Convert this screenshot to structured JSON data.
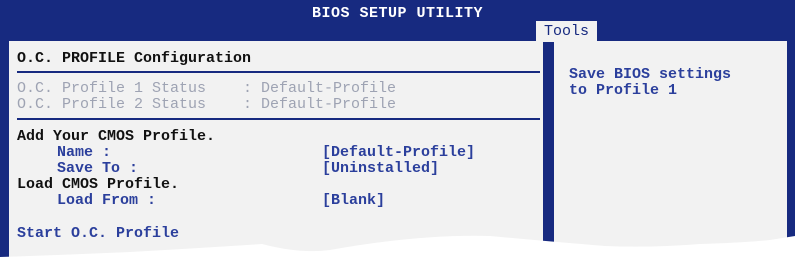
{
  "header": {
    "title": "BIOS SETUP UTILITY",
    "active_tab": "Tools"
  },
  "main": {
    "section_title": "O.C. PROFILE Configuration",
    "status_rows": [
      {
        "label": "O.C. Profile 1 Status",
        "value": ": Default-Profile"
      },
      {
        "label": "O.C. Profile 2 Status",
        "value": ": Default-Profile"
      }
    ],
    "add_heading": "Add Your CMOS Profile.",
    "name_item": {
      "label": "Name :",
      "value": "[Default-Profile]"
    },
    "save_item": {
      "label": "Save To :",
      "value": "[Uninstalled]"
    },
    "load_heading": "Load CMOS Profile.",
    "load_item": {
      "label": "Load From :",
      "value": "[Blank]"
    },
    "start_item": "Start O.C. Profile"
  },
  "help": {
    "line1": "Save BIOS settings",
    "line2": "to Profile 1"
  },
  "colors": {
    "frame": "#172a80",
    "panel": "#f2f2f2",
    "item_blue": "#2b3f9c",
    "disabled_gray": "#9ea3b3"
  }
}
